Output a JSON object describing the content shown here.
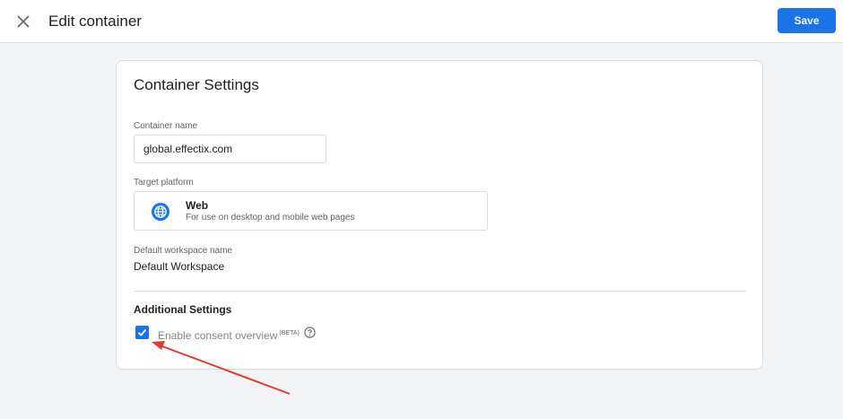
{
  "header": {
    "title": "Edit container",
    "save_label": "Save"
  },
  "card": {
    "title": "Container Settings",
    "container_name_label": "Container name",
    "container_name_value": "global.effectix.com",
    "target_platform_label": "Target platform",
    "platform": {
      "name": "Web",
      "description": "For use on desktop and mobile web pages",
      "icon": "globe-icon"
    },
    "workspace_label": "Default workspace name",
    "workspace_value": "Default Workspace",
    "additional_title": "Additional Settings",
    "consent": {
      "label": "Enable consent overview",
      "badge": "(BETA)",
      "checked": true
    }
  },
  "colors": {
    "accent": "#1a73e8",
    "annotation": "#e53935"
  }
}
